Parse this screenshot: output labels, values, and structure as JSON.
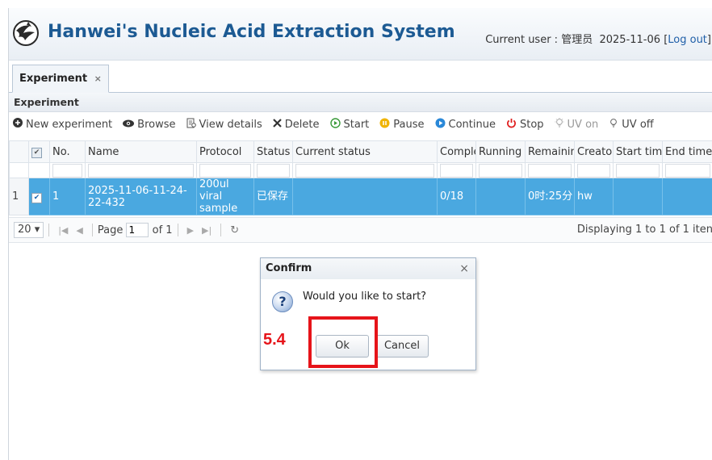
{
  "header": {
    "title": "Hanwei's Nucleic Acid Extraction System",
    "user_prefix": "Current user :",
    "user_name": "管理员",
    "date": "2025-11-06",
    "logout": "Log out"
  },
  "tabs": [
    {
      "label": "Experiment",
      "close": "×"
    }
  ],
  "panel": {
    "title": "Experiment"
  },
  "toolbar": [
    {
      "label": "New experiment",
      "icon": "plus-circle-icon",
      "enabled": true
    },
    {
      "label": "Browse",
      "icon": "eye-icon",
      "enabled": true
    },
    {
      "label": "View details",
      "icon": "document-icon",
      "enabled": true
    },
    {
      "label": "Delete",
      "icon": "x-icon",
      "enabled": true
    },
    {
      "label": "Start",
      "icon": "play-circle-icon",
      "enabled": true
    },
    {
      "label": "Pause",
      "icon": "pause-circle-icon",
      "enabled": true
    },
    {
      "label": "Continue",
      "icon": "continue-icon",
      "enabled": true
    },
    {
      "label": "Stop",
      "icon": "power-icon",
      "enabled": true
    },
    {
      "label": "UV on",
      "icon": "bulb-icon",
      "enabled": false
    },
    {
      "label": "UV off",
      "icon": "bulb-icon",
      "enabled": true
    }
  ],
  "table": {
    "columns": [
      "No.",
      "Name",
      "Protocol",
      "Status",
      "Current status",
      "Comple",
      "Running t",
      "Remainin",
      "Creator",
      "Start time",
      "End time"
    ],
    "rows": [
      {
        "row_number": "1",
        "no": "1",
        "name": "2025-11-06-11-24-22-432",
        "protocol": "200ul viral sample",
        "status": "已保存",
        "current_status": "",
        "complete": "0/18",
        "running": "",
        "remaining": "0时:25分",
        "creator": "hw",
        "start_time": "",
        "end_time": ""
      }
    ]
  },
  "pager": {
    "page_size": "20",
    "page_label": "Page",
    "page_value": "1",
    "of_label": "of 1",
    "display": "Displaying 1 to 1 of 1 iten"
  },
  "dialog": {
    "title": "Confirm",
    "close": "×",
    "message": "Would you like to start?",
    "icon": "?",
    "ok": "Ok",
    "cancel": "Cancel"
  },
  "annotation": {
    "step": "5.4"
  },
  "colors": {
    "accent": "#1c5a93",
    "selection": "#4aa8e0",
    "highlight": "#e6141a"
  }
}
